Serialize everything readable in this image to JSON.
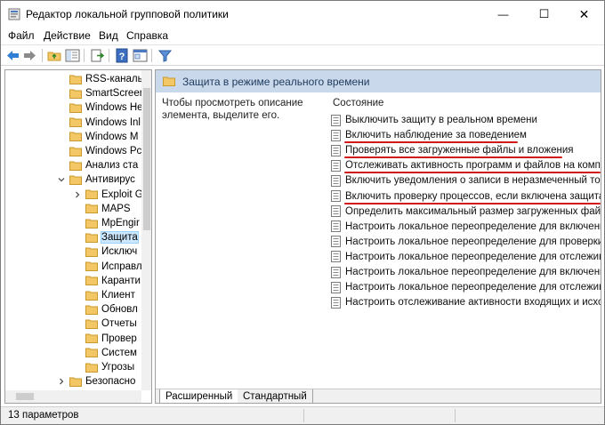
{
  "window": {
    "title": "Редактор локальной групповой политики",
    "controls": {
      "minimize": "—",
      "maximize": "☐",
      "close": "✕"
    }
  },
  "menu": [
    "Файл",
    "Действие",
    "Вид",
    "Справка"
  ],
  "toolbar": {
    "buttons": [
      "back-arrow-icon",
      "forward-arrow-icon",
      "up-folder-icon",
      "show-hide-tree-icon",
      "export-list-icon",
      "help-icon",
      "properties-icon",
      "filter-icon"
    ]
  },
  "tree": {
    "items": [
      {
        "label": "RSS-каналы"
      },
      {
        "label": "SmartScreen"
      },
      {
        "label": "Windows He"
      },
      {
        "label": "Windows Inl"
      },
      {
        "label": "Windows M"
      },
      {
        "label": "Windows Pc"
      },
      {
        "label": "Анализ ста"
      },
      {
        "label": "Антивирус"
      },
      {
        "label": "Exploit G"
      },
      {
        "label": "MAPS"
      },
      {
        "label": "MpEngir"
      },
      {
        "label": "Защита"
      },
      {
        "label": "Исключ"
      },
      {
        "label": "Исправл"
      },
      {
        "label": "Каранти"
      },
      {
        "label": "Клиент"
      },
      {
        "label": "Обновл"
      },
      {
        "label": "Отчеты"
      },
      {
        "label": "Провер"
      },
      {
        "label": "Систем"
      },
      {
        "label": "Угрозы"
      },
      {
        "label": "Безопасно"
      }
    ]
  },
  "right": {
    "header": "Защита в режиме реального времени",
    "description": "Чтобы просмотреть описание элемента, выделите его.",
    "column_header": "Состояние",
    "settings": [
      "Выключить защиту в реальном времени",
      "Включить наблюдение за поведением",
      "Проверять все загруженные файлы и вложения",
      "Отслеживать активность программ и файлов на компью...",
      "Включить уведомления о записи в неразмеченный том",
      "Включить проверку процессов, если включена защита в ...",
      "Определить максимальный размер загруженных файлов ...",
      "Настроить локальное переопределение для включения з...",
      "Настроить локальное переопределение для проверки вс...",
      "Настроить локальное переопределение для отслеживан...",
      "Настроить локальное переопределение для включения з...",
      "Настроить локальное переопределение для отслеживан...",
      "Настроить отслеживание активности входящих и исходя..."
    ],
    "highlighted": [
      1,
      2,
      3,
      5
    ],
    "tabs": [
      "Расширенный",
      "Стандартный"
    ]
  },
  "status": {
    "text": "13 параметров"
  },
  "colors": {
    "accent_header": "#c9d8eb",
    "annotation_red": "#d11919",
    "folder": "#f3c766"
  }
}
